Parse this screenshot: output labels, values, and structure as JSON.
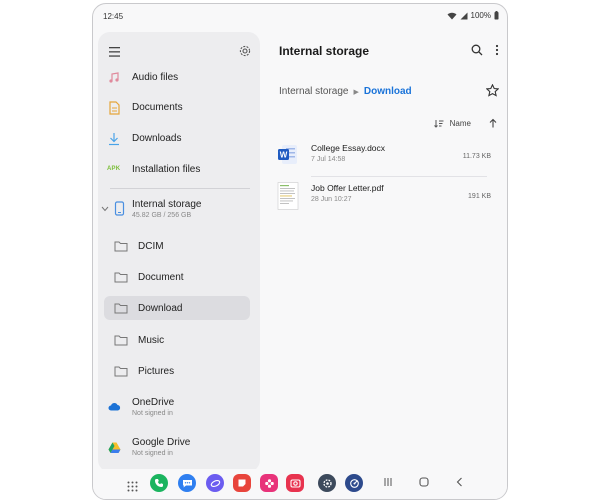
{
  "status": {
    "time": "12:45",
    "battery": "100%"
  },
  "drawer": {
    "categories": [
      {
        "label": "Audio files"
      },
      {
        "label": "Documents"
      },
      {
        "label": "Downloads"
      },
      {
        "label": "Installation files",
        "badge": "APK"
      }
    ],
    "storage": {
      "label": "Internal storage",
      "sub": "45.82 GB / 256 GB"
    },
    "folders": [
      {
        "label": "DCIM"
      },
      {
        "label": "Document"
      },
      {
        "label": "Download",
        "selected": true
      },
      {
        "label": "Music"
      },
      {
        "label": "Pictures"
      }
    ],
    "clouds": [
      {
        "label": "OneDrive",
        "sub": "Not signed in"
      },
      {
        "label": "Google Drive",
        "sub": "Not signed in"
      }
    ]
  },
  "content": {
    "title": "Internal storage",
    "breadcrumb": {
      "root": "Internal storage",
      "separator": "▶",
      "current": "Download"
    },
    "sort_label": "Name",
    "files": [
      {
        "name": "College Essay.docx",
        "date": "7 Jul 14:58",
        "size": "11.73 KB",
        "icon": "word-icon"
      },
      {
        "name": "Job Offer Letter.pdf",
        "date": "28 Jun 10:27",
        "size": "191 KB",
        "icon": "pdf-thumb-icon"
      }
    ]
  },
  "colors": {
    "accent": "#1a73d9",
    "drawer_bg": "#ededef",
    "selected_bg": "#dcdce0"
  }
}
